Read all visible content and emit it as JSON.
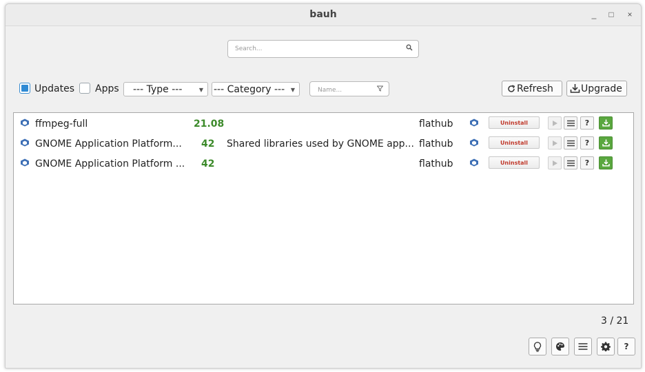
{
  "window": {
    "title": "bauh"
  },
  "search": {
    "placeholder": "Search..."
  },
  "toolbar": {
    "updates_label": "Updates",
    "updates_checked": true,
    "apps_label": "Apps",
    "apps_checked": false,
    "type_combo": "--- Type ---",
    "category_combo": "--- Category ---",
    "name_filter_placeholder": "Name...",
    "refresh_label": "Refresh",
    "upgrade_label": "Upgrade"
  },
  "packages": [
    {
      "name": "ffmpeg-full",
      "version": "21.08",
      "description": "",
      "source": "flathub",
      "uninstall_label": "Uninstall"
    },
    {
      "name": "GNOME Application Platform...",
      "version": "42",
      "description": "Shared libraries used by GNOME app...",
      "source": "flathub",
      "uninstall_label": "Uninstall"
    },
    {
      "name": "GNOME Application Platform ...",
      "version": "42",
      "description": "",
      "source": "flathub",
      "uninstall_label": "Uninstall"
    }
  ],
  "pagination": {
    "text": "3 / 21"
  },
  "colors": {
    "version_green": "#3c8a2a",
    "update_green": "#5aa73f",
    "uninstall_red": "#c0392b",
    "checkbox_blue": "#2f8ad4"
  },
  "icons": [
    "search-icon",
    "filter-icon",
    "refresh-icon",
    "download-icon",
    "flatpak-icon",
    "run-icon",
    "menu-icon",
    "help-icon",
    "lightbulb-icon",
    "palette-icon",
    "settings-icon"
  ]
}
